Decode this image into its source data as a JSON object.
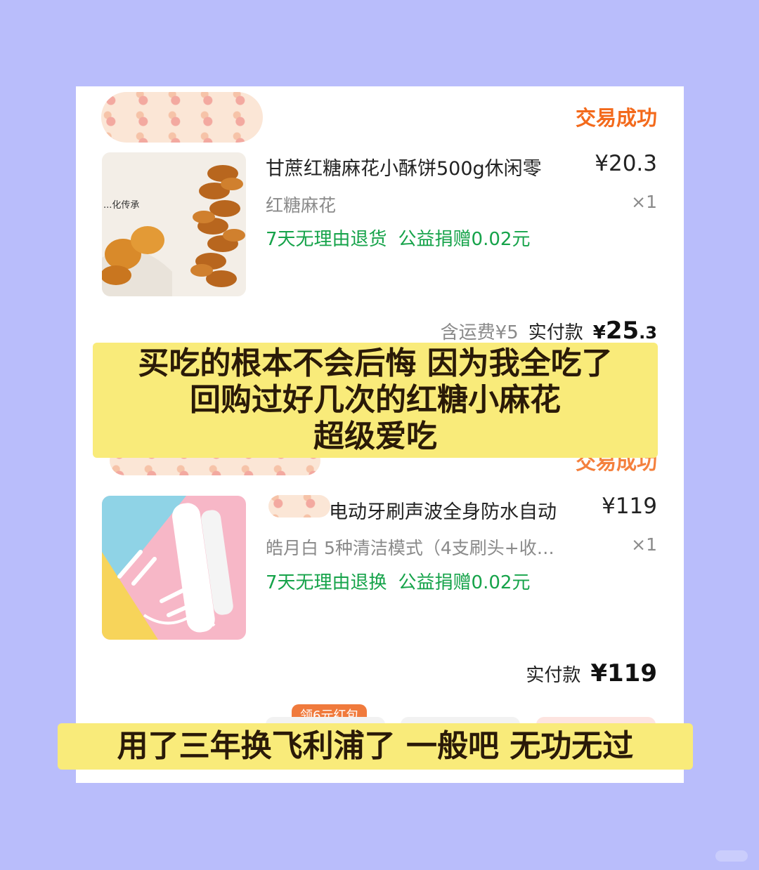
{
  "orders": [
    {
      "status": "交易成功",
      "title": "甘蔗红糖麻花小酥饼500g休闲零",
      "price": "¥20.3",
      "spec": "红糖麻花",
      "quantity": "×1",
      "tags": [
        "7天无理由退货",
        "公益捐赠0.02元"
      ],
      "image_caption": "...化传承",
      "shipping": "含运费¥5",
      "paid_label": "实付款",
      "paid_currency": "¥",
      "paid_main": "25",
      "paid_decimal": ".3"
    },
    {
      "status": "交易成功",
      "title": "电动牙刷声波全身防水自动",
      "price": "¥119",
      "spec": "皓月白 5种清洁模式（4支刷头+收…",
      "quantity": "×1",
      "tags": [
        "7天无理由退换",
        "公益捐赠0.02元"
      ],
      "paid_label": "实付款",
      "paid_amount": "¥119"
    }
  ],
  "coupon_label": "领6元红包",
  "overlay_text": {
    "line1": "买吃的根本不会后悔 因为我全吃了",
    "line2": "回购过好几次的红糖小麻花",
    "line3": "超级爱吃",
    "bottom": "用了三年换飞利浦了 一般吧 无功无过"
  },
  "colors": {
    "background": "#b9bdfb",
    "status": "#f36a1c",
    "tag": "#16a34a",
    "banner": "#f9eb7a"
  }
}
